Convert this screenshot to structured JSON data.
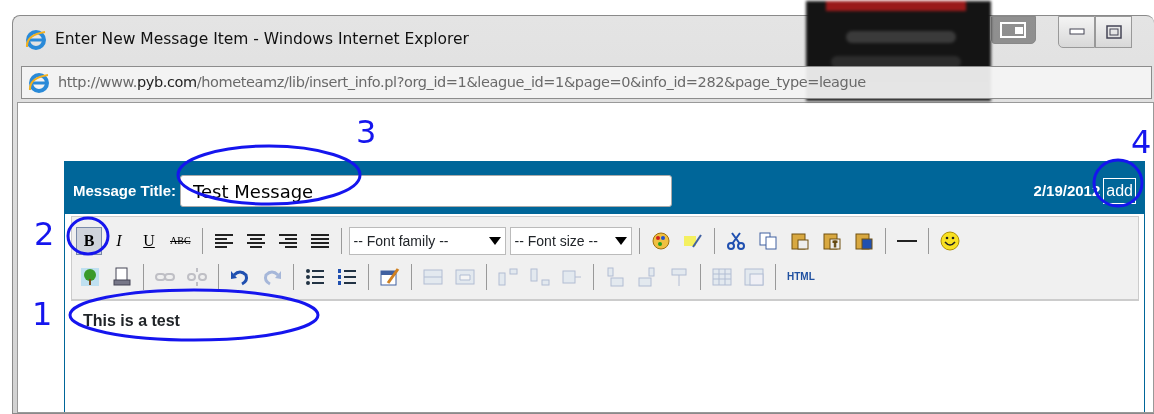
{
  "window": {
    "title": "Enter New Message Item - Windows Internet Explorer"
  },
  "address_bar": {
    "url_prefix": "http://www.",
    "url_domain": "pyb.com",
    "url_path": "/hometeamz/lib/insert_info.pl?org_id=1&league_id=1&page=0&info_id=282&page_type=league"
  },
  "editor": {
    "title_label": "Message Title:",
    "title_value": "Test Message",
    "date": "2/19/2012",
    "add_link": "add",
    "toolbar_rows": [
      [
        {
          "kind": "button",
          "label": "B",
          "selected": true,
          "disabled": false
        },
        {
          "kind": "button",
          "label": "I",
          "selected": false,
          "disabled": false
        },
        {
          "kind": "button",
          "label": "U",
          "selected": false,
          "disabled": false
        },
        {
          "kind": "button",
          "label": "ABC",
          "selected": false,
          "disabled": false
        },
        {
          "kind": "separator"
        },
        {
          "kind": "icon",
          "selected": false,
          "disabled": false
        },
        {
          "kind": "icon",
          "selected": false,
          "disabled": false
        },
        {
          "kind": "icon",
          "selected": false,
          "disabled": false
        },
        {
          "kind": "icon",
          "selected": false,
          "disabled": false
        },
        {
          "kind": "separator"
        },
        {
          "kind": "select",
          "label": "-- Font family --"
        },
        {
          "kind": "select",
          "label": "-- Font size --"
        },
        {
          "kind": "separator"
        },
        {
          "kind": "icon",
          "selected": false,
          "disabled": false
        },
        {
          "kind": "icon",
          "selected": false,
          "disabled": false
        },
        {
          "kind": "separator"
        },
        {
          "kind": "icon",
          "selected": false,
          "disabled": false
        },
        {
          "kind": "icon",
          "selected": false,
          "disabled": false
        },
        {
          "kind": "icon",
          "selected": false,
          "disabled": false
        },
        {
          "kind": "icon",
          "selected": false,
          "disabled": false
        },
        {
          "kind": "icon",
          "selected": false,
          "disabled": false
        },
        {
          "kind": "separator"
        },
        {
          "kind": "icon",
          "selected": false,
          "disabled": false
        },
        {
          "kind": "separator"
        },
        {
          "kind": "icon",
          "selected": false,
          "disabled": false
        }
      ],
      [
        {
          "kind": "icon",
          "selected": false,
          "disabled": false
        },
        {
          "kind": "icon",
          "selected": false,
          "disabled": false
        },
        {
          "kind": "separator"
        },
        {
          "kind": "icon",
          "selected": false,
          "disabled": true
        },
        {
          "kind": "icon",
          "selected": false,
          "disabled": true
        },
        {
          "kind": "separator"
        },
        {
          "kind": "icon",
          "selected": false,
          "disabled": false
        },
        {
          "kind": "icon",
          "selected": false,
          "disabled": true
        },
        {
          "kind": "separator"
        },
        {
          "kind": "icon",
          "selected": false,
          "disabled": false
        },
        {
          "kind": "icon",
          "selected": false,
          "disabled": false
        },
        {
          "kind": "separator"
        },
        {
          "kind": "icon",
          "selected": false,
          "disabled": false
        },
        {
          "kind": "separator"
        },
        {
          "kind": "icon",
          "selected": false,
          "disabled": true
        },
        {
          "kind": "icon",
          "selected": false,
          "disabled": true
        },
        {
          "kind": "separator"
        },
        {
          "kind": "icon",
          "selected": false,
          "disabled": true
        },
        {
          "kind": "icon",
          "selected": false,
          "disabled": true
        },
        {
          "kind": "icon",
          "selected": false,
          "disabled": true
        },
        {
          "kind": "separator"
        },
        {
          "kind": "icon",
          "selected": false,
          "disabled": true
        },
        {
          "kind": "icon",
          "selected": false,
          "disabled": true
        },
        {
          "kind": "icon",
          "selected": false,
          "disabled": true
        },
        {
          "kind": "separator"
        },
        {
          "kind": "icon",
          "selected": false,
          "disabled": true
        },
        {
          "kind": "icon",
          "selected": false,
          "disabled": true
        },
        {
          "kind": "separator"
        },
        {
          "kind": "button",
          "label": "HTML",
          "selected": false,
          "disabled": false
        }
      ]
    ],
    "body_text": "This is a test"
  },
  "annotations": [
    {
      "label": "1"
    },
    {
      "label": "2"
    },
    {
      "label": "3"
    },
    {
      "label": "4"
    }
  ]
}
